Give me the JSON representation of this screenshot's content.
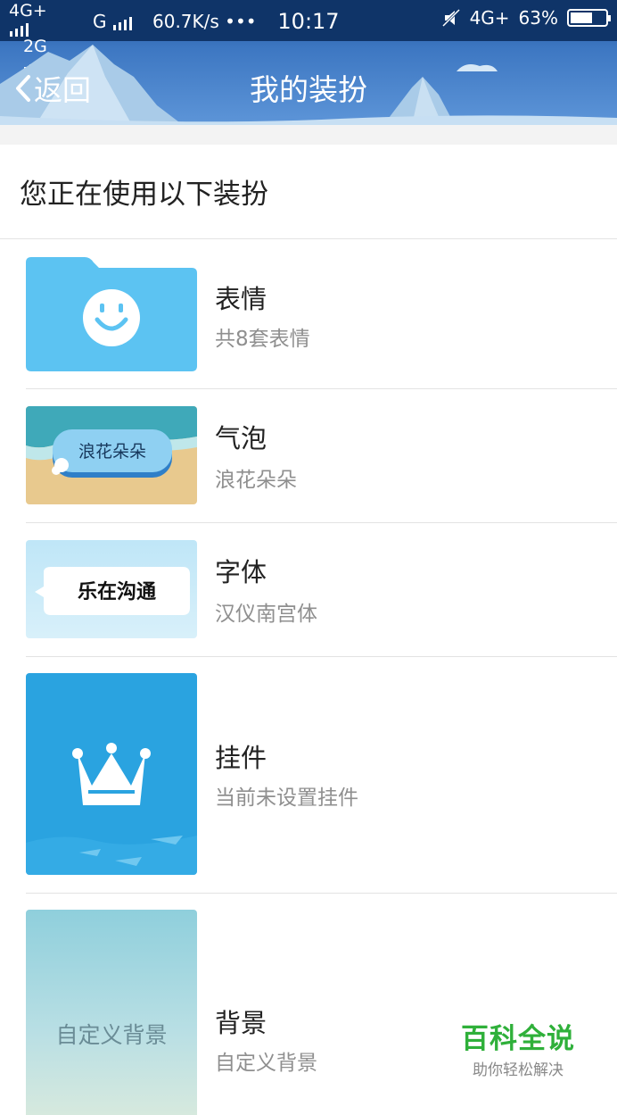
{
  "status_bar": {
    "net_top": "4G+",
    "net_bottom": "2G",
    "net_g": "G",
    "speed": "60.7K/s",
    "dots": "•••",
    "time": "10:17",
    "net_right": "4G+",
    "battery_text": "63%",
    "battery_level": 0.63
  },
  "nav": {
    "back_label": "返回",
    "title": "我的装扮"
  },
  "section_title": "您正在使用以下装扮",
  "items": [
    {
      "title": "表情",
      "subtitle": "共8套表情"
    },
    {
      "title": "气泡",
      "subtitle": "浪花朵朵",
      "thumb_text": "浪花朵朵"
    },
    {
      "title": "字体",
      "subtitle": "汉仪南宫体",
      "thumb_text": "乐在沟通"
    },
    {
      "title": "挂件",
      "subtitle": "当前未设置挂件"
    },
    {
      "title": "背景",
      "subtitle": "自定义背景",
      "thumb_text": "自定义背景"
    }
  ],
  "watermark": {
    "main": "百科全说",
    "sub": "助你轻松解决"
  },
  "colors": {
    "header_top": "#0f3468",
    "header_bar": "#3d77c2",
    "watermark_green": "#2fb03a"
  }
}
